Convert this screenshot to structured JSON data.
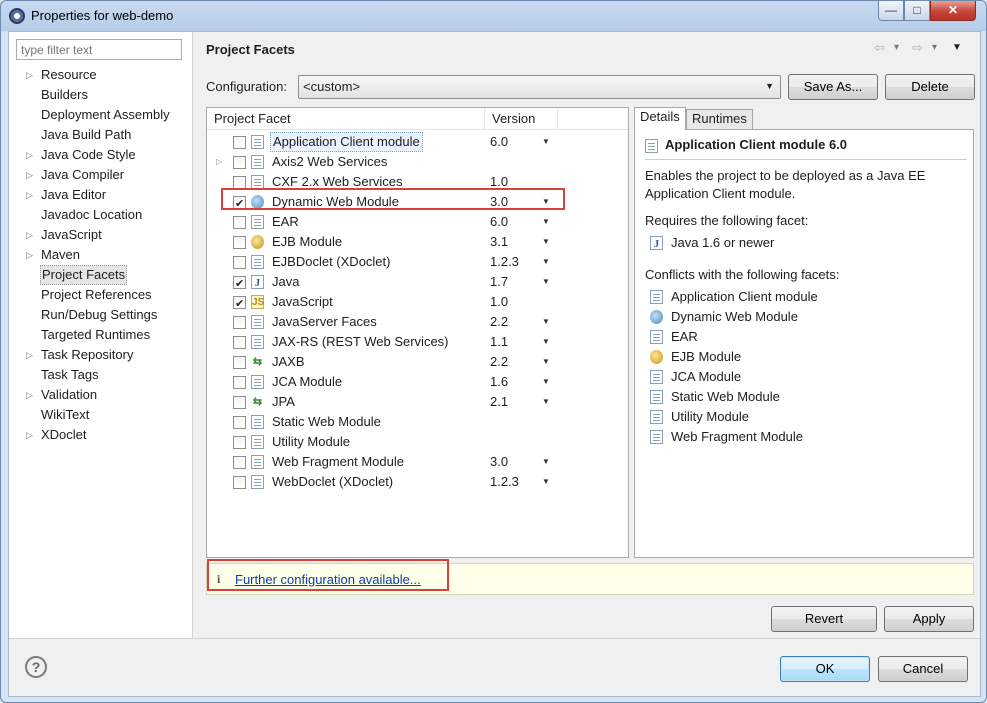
{
  "window": {
    "title": "Properties for web-demo",
    "min": "—",
    "max": "□",
    "close": "✕"
  },
  "filter": {
    "placeholder": "type filter text"
  },
  "tree": {
    "items": [
      {
        "label": "Resource",
        "expandable": true
      },
      {
        "label": "Builders",
        "expandable": false
      },
      {
        "label": "Deployment Assembly",
        "expandable": false
      },
      {
        "label": "Java Build Path",
        "expandable": false
      },
      {
        "label": "Java Code Style",
        "expandable": true
      },
      {
        "label": "Java Compiler",
        "expandable": true
      },
      {
        "label": "Java Editor",
        "expandable": true
      },
      {
        "label": "Javadoc Location",
        "expandable": false
      },
      {
        "label": "JavaScript",
        "expandable": true
      },
      {
        "label": "Maven",
        "expandable": true
      },
      {
        "label": "Project Facets",
        "expandable": false,
        "selected": true
      },
      {
        "label": "Project References",
        "expandable": false
      },
      {
        "label": "Run/Debug Settings",
        "expandable": false
      },
      {
        "label": "Targeted Runtimes",
        "expandable": false
      },
      {
        "label": "Task Repository",
        "expandable": true
      },
      {
        "label": "Task Tags",
        "expandable": false
      },
      {
        "label": "Validation",
        "expandable": true
      },
      {
        "label": "WikiText",
        "expandable": false
      },
      {
        "label": "XDoclet",
        "expandable": true
      }
    ]
  },
  "page": {
    "title": "Project Facets"
  },
  "nav": {
    "back": "⇦",
    "back_menu": "▾",
    "forward": "⇨",
    "forward_menu": "▾",
    "view_menu": "▼"
  },
  "configuration": {
    "label": "Configuration:",
    "value": "<custom>",
    "save_as": "Save As...",
    "delete": "Delete"
  },
  "facets": {
    "header": {
      "facet": "Project Facet",
      "version": "Version"
    },
    "rows": [
      {
        "name": "Application Client module",
        "version": "6.0",
        "dropdown": true,
        "checked": false,
        "icon": "doc-icon",
        "selected": true
      },
      {
        "name": "Axis2 Web Services",
        "version": "",
        "dropdown": false,
        "checked": false,
        "icon": "doc-icon",
        "expandable": true
      },
      {
        "name": "CXF 2.x Web Services",
        "version": "1.0",
        "dropdown": false,
        "checked": false,
        "icon": "doc-icon"
      },
      {
        "name": "Dynamic Web Module",
        "version": "3.0",
        "dropdown": true,
        "checked": true,
        "icon": "globe-icon"
      },
      {
        "name": "EAR",
        "version": "6.0",
        "dropdown": true,
        "checked": false,
        "icon": "doc-icon"
      },
      {
        "name": "EJB Module",
        "version": "3.1",
        "dropdown": true,
        "checked": false,
        "icon": "ejb-icon"
      },
      {
        "name": "EJBDoclet (XDoclet)",
        "version": "1.2.3",
        "dropdown": true,
        "checked": false,
        "icon": "doc-icon"
      },
      {
        "name": "Java",
        "version": "1.7",
        "dropdown": true,
        "checked": true,
        "icon": "java-icon"
      },
      {
        "name": "JavaScript",
        "version": "1.0",
        "dropdown": false,
        "checked": true,
        "icon": "javascript-icon"
      },
      {
        "name": "JavaServer Faces",
        "version": "2.2",
        "dropdown": true,
        "checked": false,
        "icon": "doc-icon"
      },
      {
        "name": "JAX-RS (REST Web Services)",
        "version": "1.1",
        "dropdown": true,
        "checked": false,
        "icon": "doc-icon"
      },
      {
        "name": "JAXB",
        "version": "2.2",
        "dropdown": true,
        "checked": false,
        "icon": "arrows-icon"
      },
      {
        "name": "JCA Module",
        "version": "1.6",
        "dropdown": true,
        "checked": false,
        "icon": "doc-icon"
      },
      {
        "name": "JPA",
        "version": "2.1",
        "dropdown": true,
        "checked": false,
        "icon": "arrows-icon"
      },
      {
        "name": "Static Web Module",
        "version": "",
        "dropdown": false,
        "checked": false,
        "icon": "doc-icon"
      },
      {
        "name": "Utility Module",
        "version": "",
        "dropdown": false,
        "checked": false,
        "icon": "doc-icon"
      },
      {
        "name": "Web Fragment Module",
        "version": "3.0",
        "dropdown": true,
        "checked": false,
        "icon": "doc-icon"
      },
      {
        "name": "WebDoclet (XDoclet)",
        "version": "1.2.3",
        "dropdown": true,
        "checked": false,
        "icon": "doc-icon"
      }
    ]
  },
  "details": {
    "tabs": [
      "Details",
      "Runtimes"
    ],
    "heading": "Application Client module 6.0",
    "description_line1": "Enables the project to be deployed as a Java EE",
    "description_line2": "Application Client module.",
    "requires_label": "Requires the following facet:",
    "requires": [
      {
        "name": "Java 1.6 or newer",
        "icon": "java-icon"
      }
    ],
    "conflicts_label": "Conflicts with the following facets:",
    "conflicts": [
      {
        "name": "Application Client module",
        "icon": "doc-icon"
      },
      {
        "name": "Dynamic Web Module",
        "icon": "globe-icon"
      },
      {
        "name": "EAR",
        "icon": "doc-icon"
      },
      {
        "name": "EJB Module",
        "icon": "ejb-icon"
      },
      {
        "name": "JCA Module",
        "icon": "doc-icon"
      },
      {
        "name": "Static Web Module",
        "icon": "doc-icon"
      },
      {
        "name": "Utility Module",
        "icon": "doc-icon"
      },
      {
        "name": "Web Fragment Module",
        "icon": "doc-icon"
      }
    ]
  },
  "info": {
    "icon": "i",
    "link": "Further configuration available..."
  },
  "buttons": {
    "revert": "Revert",
    "apply": "Apply",
    "ok": "OK",
    "cancel": "Cancel",
    "help": "?"
  },
  "colors": {
    "highlight": "#d6433d",
    "link": "#0b3fa5",
    "infobar_bg": "#fffee8"
  }
}
